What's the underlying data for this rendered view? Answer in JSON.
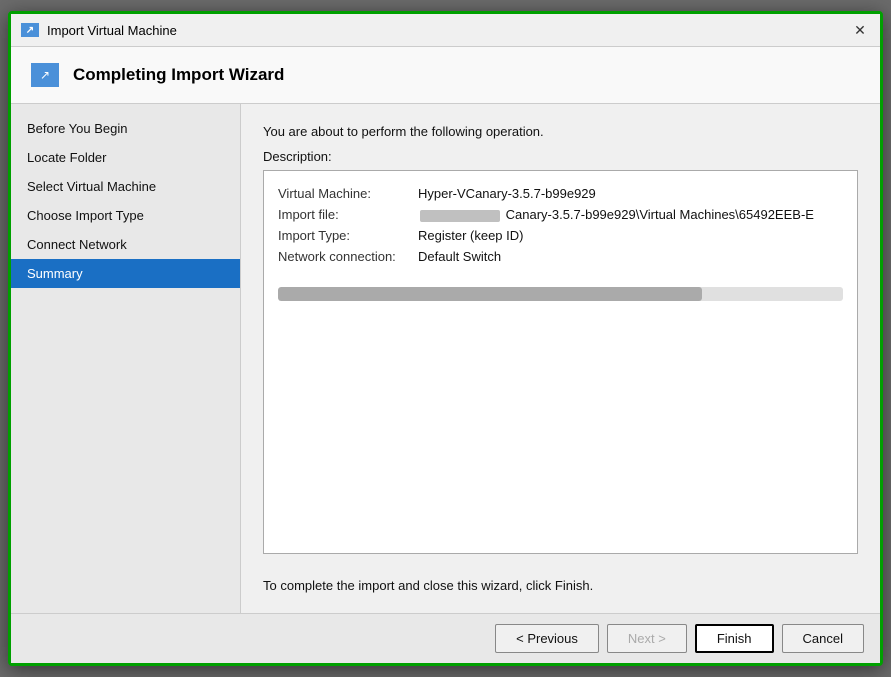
{
  "window": {
    "title": "Import Virtual Machine",
    "close_label": "✕"
  },
  "header": {
    "icon_label": "↗",
    "title": "Completing Import Wizard"
  },
  "sidebar": {
    "items": [
      {
        "id": "before-you-begin",
        "label": "Before You Begin",
        "active": false
      },
      {
        "id": "locate-folder",
        "label": "Locate Folder",
        "active": false
      },
      {
        "id": "select-virtual-machine",
        "label": "Select Virtual Machine",
        "active": false
      },
      {
        "id": "choose-import-type",
        "label": "Choose Import Type",
        "active": false
      },
      {
        "id": "connect-network",
        "label": "Connect Network",
        "active": false
      },
      {
        "id": "summary",
        "label": "Summary",
        "active": true
      }
    ]
  },
  "main": {
    "intro_text": "You are about to perform the following operation.",
    "description_label": "Description:",
    "table_rows": [
      {
        "label": "Virtual Machine:",
        "value": "Hyper-VCanary-3.5.7-b99e929",
        "has_redacted": false
      },
      {
        "label": "Import file:",
        "value": "Canary-3.5.7-b99e929\\Virtual Machines\\65492EEB-E",
        "has_redacted": true
      },
      {
        "label": "Import Type:",
        "value": "Register (keep ID)",
        "has_redacted": false
      },
      {
        "label": "Network connection:",
        "value": "Default Switch",
        "has_redacted": false
      }
    ],
    "finish_text": "To complete the import and close this wizard, click Finish."
  },
  "footer": {
    "previous_label": "< Previous",
    "next_label": "Next >",
    "finish_label": "Finish",
    "cancel_label": "Cancel"
  }
}
